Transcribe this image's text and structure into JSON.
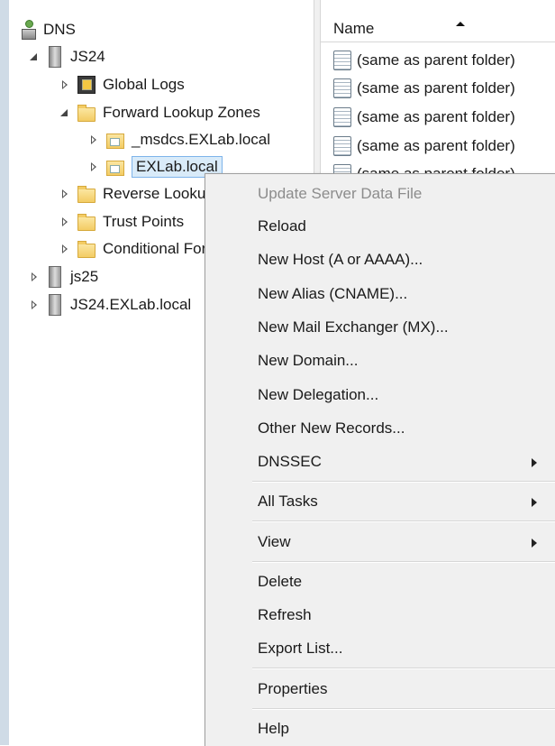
{
  "tree": {
    "root_label": "DNS",
    "servers": [
      {
        "label": "JS24"
      },
      {
        "label": "js25"
      },
      {
        "label": "JS24.EXLab.local"
      }
    ],
    "nodes": {
      "global_logs": "Global Logs",
      "forward_lookup_zones": "Forward Lookup Zones",
      "msdcs": "_msdcs.EXLab.local",
      "exlab": "EXLab.local",
      "reverse": "Reverse Lookup Zones",
      "trust_points": "Trust Points",
      "conditional": "Conditional Forwarders"
    }
  },
  "list": {
    "column_name": "Name",
    "records": [
      "(same as parent folder)",
      "(same as parent folder)",
      "(same as parent folder)",
      "(same as parent folder)",
      "(same as parent folder)"
    ]
  },
  "context_menu": {
    "items": [
      {
        "label": "Update Server Data File",
        "disabled": true
      },
      {
        "label": "Reload"
      },
      {
        "label": "New Host (A or AAAA)..."
      },
      {
        "label": "New Alias (CNAME)..."
      },
      {
        "label": "New Mail Exchanger (MX)..."
      },
      {
        "label": "New Domain..."
      },
      {
        "label": "New Delegation..."
      },
      {
        "label": "Other New Records..."
      },
      {
        "label": "DNSSEC",
        "submenu": true
      },
      {
        "label": "All Tasks",
        "submenu": true
      },
      {
        "label": "View",
        "submenu": true
      },
      {
        "label": "Delete"
      },
      {
        "label": "Refresh"
      },
      {
        "label": "Export List..."
      },
      {
        "label": "Properties"
      },
      {
        "label": "Help"
      }
    ]
  }
}
